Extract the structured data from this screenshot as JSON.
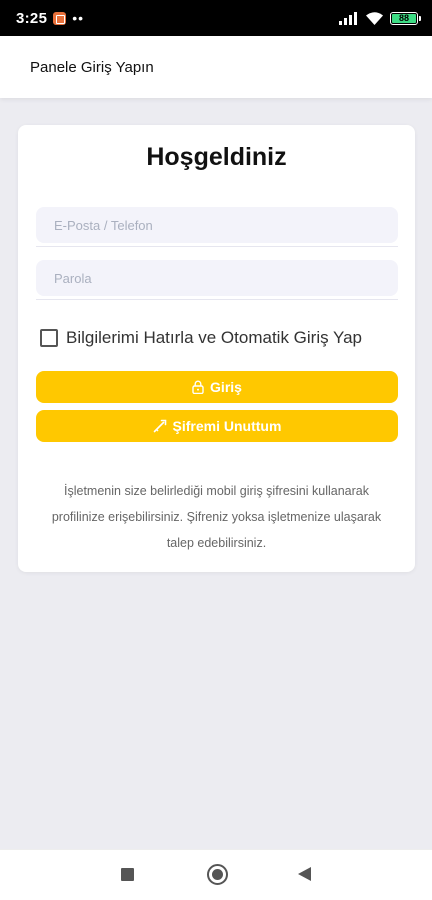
{
  "status_bar": {
    "time": "3:25",
    "dots": "••",
    "battery": "88",
    "icons": [
      "notification-app-icon",
      "signal-icon",
      "wifi-icon",
      "battery-icon"
    ]
  },
  "app_bar": {
    "title": "Panele Giriş Yapın"
  },
  "login": {
    "heading": "Hoşgeldiniz",
    "email_placeholder": "E-Posta / Telefon",
    "email_value": "",
    "password_placeholder": "Parola",
    "password_value": "",
    "remember_label": "Bilgilerimi Hatırla ve Otomatik Giriş Yap",
    "remember_checked": false,
    "login_button": "Giriş",
    "login_icon": "lock-icon",
    "forgot_button": "Şifremi Unuttum",
    "forgot_icon": "key-icon",
    "info_text": "İşletmenin size belirlediği mobil giriş şifresini kullanarak profilinize erişebilirsiniz. Şifreniz yoksa işletmenize ulaşarak talep edebilirsiniz."
  },
  "colors": {
    "accent": "#ffc800",
    "background": "#ececf1",
    "field_bg": "#f3f3fa"
  },
  "nav_bar": {
    "icons": [
      "recent-apps-icon",
      "home-icon",
      "back-icon"
    ]
  }
}
